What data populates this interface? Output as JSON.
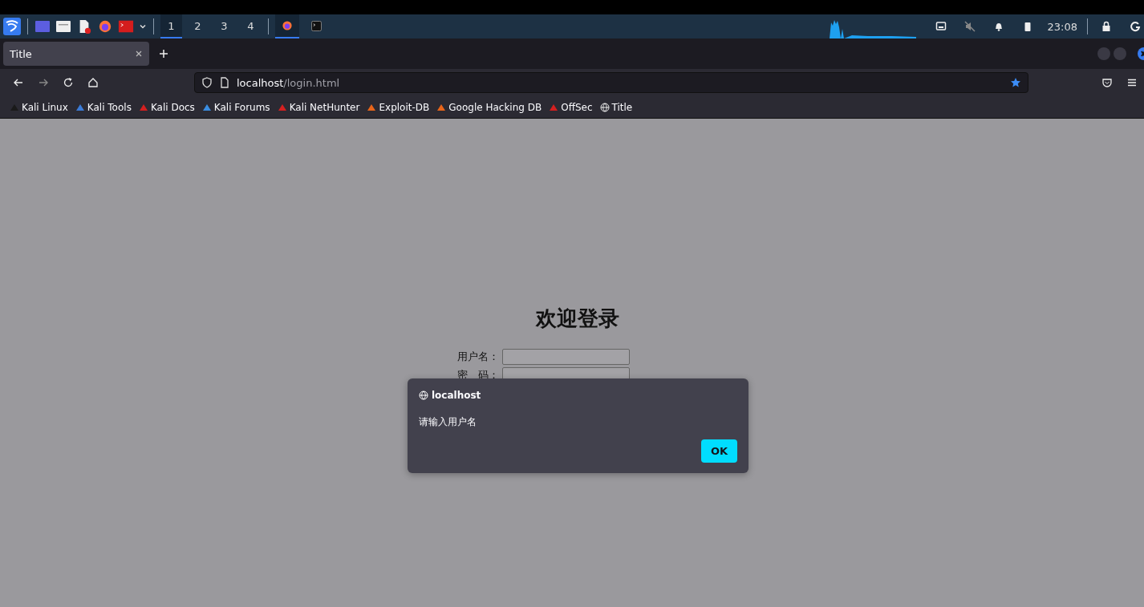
{
  "taskbar": {
    "workspaces": [
      {
        "label": "1",
        "selected": true
      },
      {
        "label": "2",
        "selected": false
      },
      {
        "label": "3",
        "selected": false
      },
      {
        "label": "4",
        "selected": false
      }
    ],
    "windows": [
      {
        "kind": "firefox",
        "selected": true
      },
      {
        "kind": "terminal",
        "selected": false
      }
    ],
    "clock": "23:08"
  },
  "browser": {
    "tabs": [
      {
        "label": "Title",
        "selected": true
      }
    ],
    "url": {
      "host": "localhost",
      "path": "/login.html"
    },
    "bookmarked": true,
    "bookmarks": [
      {
        "label": "Kali Linux",
        "color": "#1a1a1a"
      },
      {
        "label": "Kali Tools",
        "color": "#3b7bd6"
      },
      {
        "label": "Kali Docs",
        "color": "#d42020"
      },
      {
        "label": "Kali Forums",
        "color": "#3a8de0"
      },
      {
        "label": "Kali NetHunter",
        "color": "#d42020"
      },
      {
        "label": "Exploit-DB",
        "color": "#e8651a"
      },
      {
        "label": "Google Hacking DB",
        "color": "#e8651a"
      },
      {
        "label": "OffSec",
        "color": "#d42020"
      },
      {
        "label": "Title",
        "kind": "globe"
      }
    ]
  },
  "page": {
    "heading": "欢迎登录",
    "fields": [
      {
        "label": "用户名："
      },
      {
        "label": "密　码："
      }
    ]
  },
  "dialog": {
    "origin": "localhost",
    "message": "请输入用户名",
    "button": "OK"
  }
}
